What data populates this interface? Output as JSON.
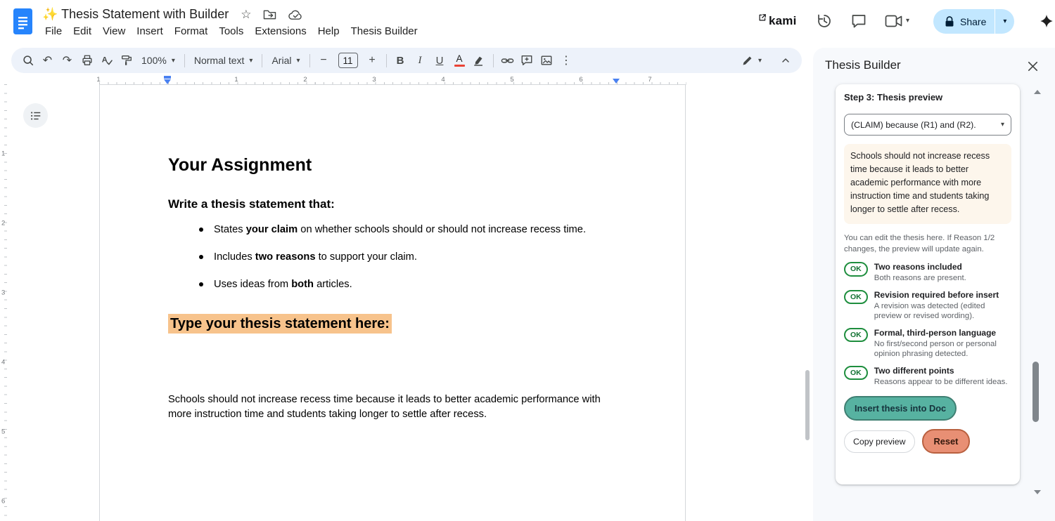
{
  "header": {
    "doc_title": "✨ Thesis Statement with Builder",
    "menus": [
      "File",
      "Edit",
      "View",
      "Insert",
      "Format",
      "Tools",
      "Extensions",
      "Help",
      "Thesis Builder"
    ],
    "kami_label": "kami",
    "share_label": "Share"
  },
  "toolbar": {
    "zoom": "100%",
    "style": "Normal text",
    "font": "Arial",
    "size": "11",
    "minus": "−",
    "plus": "+",
    "bold_glyph": "B",
    "italic_glyph": "I",
    "underline_glyph": "U",
    "text_color_glyph": "A",
    "spellcheck_letter": "A"
  },
  "ruler": {
    "h": [
      "1",
      "1",
      "2",
      "3",
      "4",
      "5",
      "6",
      "7"
    ],
    "v": [
      "1",
      "2",
      "3",
      "4",
      "5",
      "6"
    ]
  },
  "document": {
    "heading": "Your Assignment",
    "subheading": "Write a thesis statement that:",
    "bullets": [
      {
        "pre": "States ",
        "bold": "your claim",
        "post": " on whether schools should or should not increase recess time."
      },
      {
        "pre": "Includes ",
        "bold": "two reasons",
        "post": " to support your claim."
      },
      {
        "pre": "Uses ideas from ",
        "bold": "both",
        "post": " articles."
      }
    ],
    "highlight_heading": "Type your thesis statement here:",
    "paragraph": "Schools should not increase recess time because it leads to better academic performance with more instruction time and students taking longer to settle after recess."
  },
  "sidebar": {
    "title": "Thesis Builder",
    "step_title": "Step 3: Thesis preview",
    "template_option": "(CLAIM) because (R1) and (R2).",
    "preview_text": "Schools should not increase recess time because it leads to better academic performance with more instruction time and students taking longer to settle after recess.",
    "helper_text": "You can edit the thesis here. If Reason 1/2 changes, the preview will update again.",
    "checks": [
      {
        "badge": "OK",
        "title": "Two reasons included",
        "desc": "Both reasons are present."
      },
      {
        "badge": "OK",
        "title": "Revision required before insert",
        "desc": "A revision was detected (edited preview or revised wording)."
      },
      {
        "badge": "OK",
        "title": "Formal, third-person language",
        "desc": "No first/second person or personal opinion phrasing detected."
      },
      {
        "badge": "OK",
        "title": "Two different points",
        "desc": "Reasons appear to be different ideas."
      }
    ],
    "insert_label": "Insert thesis into Doc",
    "copy_label": "Copy preview",
    "reset_label": "Reset"
  },
  "colors": {
    "accent_blue": "#2684fc",
    "share_bg": "#c2e7ff",
    "toolbar_bg": "#edf2fa",
    "highlight_orange": "#f7c38c",
    "ok_green": "#1e8e3e",
    "insert_teal": "#57b2a1",
    "reset_salmon": "#e88f74",
    "preview_cream": "#fdf6ec"
  }
}
